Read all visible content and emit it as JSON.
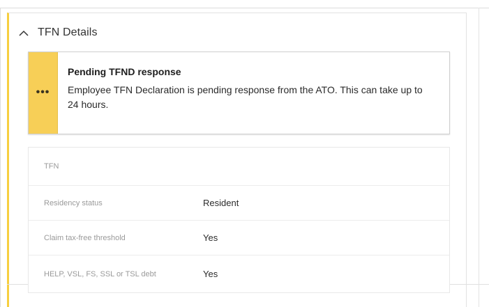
{
  "section": {
    "title": "TFN Details",
    "expanded": true,
    "accent_color": "#f7cf3f"
  },
  "alert": {
    "icon": "more-dots-icon",
    "title": "Pending TFND response",
    "message": "Employee TFN Declaration is pending response from the ATO. This can take up to 24 hours.",
    "accent_color": "#f7cf57"
  },
  "details": [
    {
      "label": "TFN",
      "value": ""
    },
    {
      "label": "Residency status",
      "value": "Resident"
    },
    {
      "label": "Claim tax-free threshold",
      "value": "Yes"
    },
    {
      "label": "HELP, VSL, FS, SSL or TSL debt",
      "value": "Yes"
    }
  ]
}
